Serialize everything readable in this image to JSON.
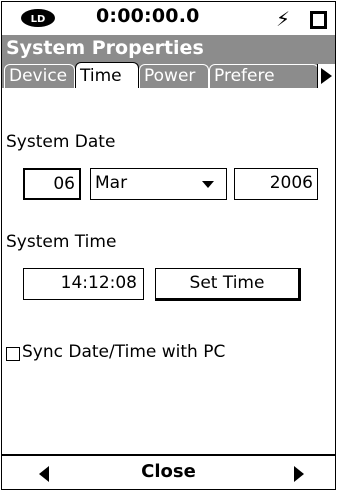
{
  "status": {
    "timer": "0:00:00.0",
    "logo_text": "LD"
  },
  "window": {
    "title": "System Properties"
  },
  "tabs": [
    {
      "label": "Device",
      "active": false
    },
    {
      "label": "Time",
      "active": true
    },
    {
      "label": "Power",
      "active": false
    },
    {
      "label": "Prefere",
      "active": false
    }
  ],
  "date": {
    "label": "System Date",
    "day": "06",
    "month": "Mar",
    "year": "2006"
  },
  "time": {
    "label": "System Time",
    "value": "14:12:08",
    "set_button": "Set Time"
  },
  "sync": {
    "label": "Sync Date/Time with PC",
    "checked": false
  },
  "footer": {
    "close_label": "Close"
  },
  "colors": {
    "titlebar": "#8c8c8c",
    "background": "#ffffff",
    "text": "#000000"
  },
  "icons": [
    "ld-logo-icon",
    "lightning-bolt-icon",
    "battery-icon",
    "tab-scroll-right-icon",
    "nav-left-arrow-icon",
    "nav-right-arrow-icon",
    "dropdown-arrow-icon"
  ]
}
